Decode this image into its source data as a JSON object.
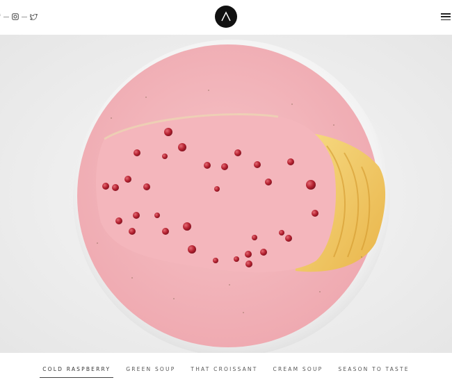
{
  "header": {
    "social_icons": [
      "facebook-icon",
      "instagram-icon",
      "twitter-icon"
    ],
    "logo_icon": "lambda-logo-icon",
    "menu_icon": "hamburger-menu-icon"
  },
  "hero": {
    "description": "",
    "colors": {
      "sauce": "#f2b3b8",
      "plate": "#f4f4f4",
      "fish": "#f0c86a",
      "berries": "#b0202e"
    }
  },
  "tabs": [
    {
      "label": "COLD RASPBERRY",
      "active": true
    },
    {
      "label": "GREEN SOUP",
      "active": false
    },
    {
      "label": "THAT CROISSANT",
      "active": false
    },
    {
      "label": "CREAM SOUP",
      "active": false
    },
    {
      "label": "SEASON TO TASTE",
      "active": false
    }
  ]
}
